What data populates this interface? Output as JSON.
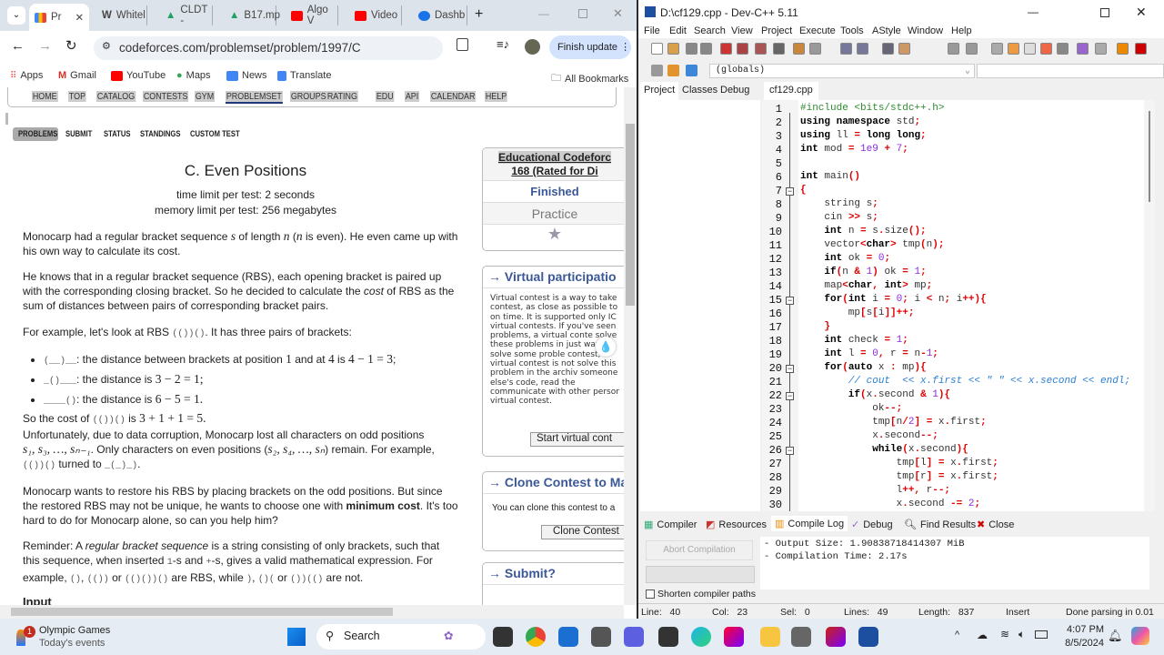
{
  "browser": {
    "tabs": [
      {
        "label": "Pr",
        "icon": "chart-icon",
        "active": true
      },
      {
        "label": "Whitel",
        "icon": "w-icon"
      },
      {
        "label": "CLDT -",
        "icon": "drive-icon"
      },
      {
        "label": "B17.mp",
        "icon": "drive-icon"
      },
      {
        "label": "Algo V",
        "icon": "youtube-icon"
      },
      {
        "label": "Video",
        "icon": "youtube-icon"
      },
      {
        "label": "Dashb",
        "icon": "dashboard-icon"
      }
    ],
    "url": "codeforces.com/problemset/problem/1997/C",
    "finish_update": "Finish update",
    "bookmarks": [
      "Apps",
      "Gmail",
      "YouTube",
      "Maps",
      "News",
      "Translate"
    ],
    "all_bookmarks": "All Bookmarks"
  },
  "cf": {
    "nav": [
      "HOME",
      "TOP",
      "CATALOG",
      "CONTESTS",
      "GYM",
      "PROBLEMSET",
      "GROUPS",
      "RATING",
      "EDU",
      "API",
      "CALENDAR",
      "HELP"
    ],
    "subnav": [
      "PROBLEMS",
      "SUBMIT",
      "STATUS",
      "STANDINGS",
      "CUSTOM TEST"
    ],
    "title": "C. Even Positions",
    "time_limit": "time limit per test: 2 seconds",
    "memory_limit": "memory limit per test: 256 megabytes",
    "p1": {
      "a": "Monocarp had a regular bracket sequence ",
      "s": "s",
      "b": " of length ",
      "n": "n",
      "c": " (",
      "n2": "n",
      "d": " is even). He even came up with his own way to calculate its cost."
    },
    "p2": {
      "a": "He knows that in a regular bracket sequence (RBS), each opening bracket is paired up with the corresponding closing bracket. So he decided to calculate the ",
      "cost": "cost",
      "b": " of RBS as the sum of distances between pairs of corresponding bracket pairs."
    },
    "p3": {
      "a": "For example, let's look at RBS ",
      "code": "(())()",
      "b": ". It has three pairs of brackets:"
    },
    "bullets": [
      {
        "code": "(__)__",
        "text": ": the distance between brackets at position ",
        "m": "1",
        " and": " and at ",
        "m2": "4",
        "is": " is ",
        "eq": "4 − 1 = 3",
        ";": ";"
      },
      {
        "code": "_()___",
        "text": ": the distance is ",
        "eq": "3 − 2 = 1;"
      },
      {
        "code": "____()",
        "text": ": the distance is ",
        "eq": "6 − 5 = 1."
      }
    ],
    "p4": {
      "a": "So the cost of ",
      "code": "(())()",
      "b": " is ",
      "eq": "3 + 1 + 1 = 5."
    },
    "p5": {
      "a": "Unfortunately, due to data corruption, Monocarp lost all characters on odd positions",
      "m1": "s₁, s₃, …, sₙ₋₁",
      "b": ". Only characters on even positions (",
      "m2": "s₂, s₄, …, sₙ",
      "c": ") remain. For example,",
      "code1": "(())()",
      "d": " turned to ",
      "code2": "_(_)_)",
      "e": "."
    },
    "p6": {
      "a": "Monocarp wants to restore his RBS by placing brackets on the odd positions. But since the restored RBS may not be unique, he wants to choose one with ",
      "b": "minimum cost",
      "c": ". It's too hard to do for Monocarp alone, so can you help him?"
    },
    "p7": {
      "a": "Reminder: A ",
      "i": "regular bracket sequence",
      "b": " is a string consisting of only brackets, such that this sequence, when inserted ",
      "c1": "1",
      "c": "-s and ",
      "c2": "+",
      "d": "-s, gives a valid mathematical expression. For example, ",
      "e1": "()",
      "sep": ", ",
      "e2": "(())",
      "or": " or ",
      "e3": "(()())()",
      "f": " are RBS, while ",
      "g1": ")",
      "g2": "()(",
      "g3": "())(()",
      "h": " are not."
    },
    "input_heading": "Input",
    "side": {
      "contest": "Educational Codeforces Round 168 (Rated for Di",
      "contest_l1": "Educational Codeforc",
      "contest_l2": "168 (Rated for Di",
      "finished": "Finished",
      "practice": "Practice",
      "virtual_title": "→ Virtual participatio",
      "virtual_text": "Virtual contest is a way to take contest, as close as possible to on time. It is supported only IC virtual contests. If you've seen problems, a virtual conte solve these problems in just want to solve some proble contest, a virtual contest is not solve this problem in the archiv someone else's code, read the communicate with other persor virtual contest.",
      "start_virtual": "Start virtual cont",
      "clone_title": "→ Clone Contest to Ma",
      "clone_text": "You can clone this contest to a",
      "clone_btn": "Clone Contest",
      "submit_title": "→ Submit?"
    }
  },
  "dev": {
    "title": "D:\\cf129.cpp - Dev-C++ 5.11",
    "menu": [
      "File",
      "Edit",
      "Search",
      "View",
      "Project",
      "Execute",
      "Tools",
      "AStyle",
      "Window",
      "Help"
    ],
    "scope": "(globals)",
    "left_tabs": [
      "Project",
      "Classes",
      "Debug"
    ],
    "file_tab": "cf129.cpp",
    "folds": [
      7,
      15,
      20,
      22,
      26
    ],
    "code": [
      [
        [
          "pp",
          "#include <bits/stdc++.h>"
        ]
      ],
      [
        [
          "k",
          "using namespace"
        ],
        [
          "t",
          " std"
        ],
        [
          "p",
          ";"
        ]
      ],
      [
        [
          "k",
          "using"
        ],
        [
          "t",
          " ll "
        ],
        [
          "p",
          "="
        ],
        [
          "k",
          " long long"
        ],
        [
          "p",
          ";"
        ]
      ],
      [
        [
          "k",
          "int"
        ],
        [
          "t",
          " mod "
        ],
        [
          "p",
          "="
        ],
        [
          "n",
          " 1e9 "
        ],
        [
          "p",
          "+"
        ],
        [
          "n",
          " 7"
        ],
        [
          "p",
          ";"
        ]
      ],
      [],
      [
        [
          "k",
          "int"
        ],
        [
          "t",
          " main"
        ],
        [
          "p",
          "()"
        ]
      ],
      [
        [
          "p",
          "{"
        ]
      ],
      [
        [
          "t",
          "    string s"
        ],
        [
          "p",
          ";"
        ]
      ],
      [
        [
          "t",
          "    cin "
        ],
        [
          "p",
          ">>"
        ],
        [
          "t",
          " s"
        ],
        [
          "p",
          ";"
        ]
      ],
      [
        [
          "k",
          "    int"
        ],
        [
          "t",
          " n "
        ],
        [
          "p",
          "="
        ],
        [
          "t",
          " s"
        ],
        [
          "p",
          "."
        ],
        [
          "t",
          "size"
        ],
        [
          "p",
          "();"
        ]
      ],
      [
        [
          "t",
          "    vector"
        ],
        [
          "p",
          "<"
        ],
        [
          "k",
          "char"
        ],
        [
          "p",
          ">"
        ],
        [
          "t",
          " tmp"
        ],
        [
          "p",
          "("
        ],
        [
          "t",
          "n"
        ],
        [
          "p",
          ");"
        ]
      ],
      [
        [
          "k",
          "    int"
        ],
        [
          "t",
          " ok "
        ],
        [
          "p",
          "="
        ],
        [
          "n",
          " 0"
        ],
        [
          "p",
          ";"
        ]
      ],
      [
        [
          "k",
          "    if"
        ],
        [
          "p",
          "("
        ],
        [
          "t",
          "n "
        ],
        [
          "p",
          "&"
        ],
        [
          "n",
          " 1"
        ],
        [
          "p",
          ")"
        ],
        [
          "t",
          " ok "
        ],
        [
          "p",
          "="
        ],
        [
          "n",
          " 1"
        ],
        [
          "p",
          ";"
        ]
      ],
      [
        [
          "t",
          "    map"
        ],
        [
          "p",
          "<"
        ],
        [
          "k",
          "char"
        ],
        [
          "p",
          ","
        ],
        [
          "k",
          " int"
        ],
        [
          "p",
          ">"
        ],
        [
          "t",
          " mp"
        ],
        [
          "p",
          ";"
        ]
      ],
      [
        [
          "k",
          "    for"
        ],
        [
          "p",
          "("
        ],
        [
          "k",
          "int"
        ],
        [
          "t",
          " i "
        ],
        [
          "p",
          "="
        ],
        [
          "n",
          " 0"
        ],
        [
          "p",
          ";"
        ],
        [
          "t",
          " i "
        ],
        [
          "p",
          "<"
        ],
        [
          "t",
          " n"
        ],
        [
          "p",
          ";"
        ],
        [
          "t",
          " i"
        ],
        [
          "p",
          "++){"
        ]
      ],
      [
        [
          "t",
          "        mp"
        ],
        [
          "p",
          "["
        ],
        [
          "t",
          "s"
        ],
        [
          "p",
          "["
        ],
        [
          "t",
          "i"
        ],
        [
          "p",
          "]]++;"
        ]
      ],
      [
        [
          "p",
          "    }"
        ]
      ],
      [
        [
          "k",
          "    int"
        ],
        [
          "t",
          " check "
        ],
        [
          "p",
          "="
        ],
        [
          "n",
          " 1"
        ],
        [
          "p",
          ";"
        ]
      ],
      [
        [
          "k",
          "    int"
        ],
        [
          "t",
          " l "
        ],
        [
          "p",
          "="
        ],
        [
          "n",
          " 0"
        ],
        [
          "p",
          ","
        ],
        [
          "t",
          " r "
        ],
        [
          "p",
          "="
        ],
        [
          "t",
          " n"
        ],
        [
          "p",
          "-"
        ],
        [
          "n",
          "1"
        ],
        [
          "p",
          ";"
        ]
      ],
      [
        [
          "k",
          "    for"
        ],
        [
          "p",
          "("
        ],
        [
          "k",
          "auto"
        ],
        [
          "t",
          " x "
        ],
        [
          "p",
          ":"
        ],
        [
          "t",
          " mp"
        ],
        [
          "p",
          "){"
        ]
      ],
      [
        [
          "t",
          "        "
        ],
        [
          "c",
          "// cout  << x.first << \" \" << x.second << endl;"
        ]
      ],
      [
        [
          "k",
          "        if"
        ],
        [
          "p",
          "("
        ],
        [
          "t",
          "x"
        ],
        [
          "p",
          "."
        ],
        [
          "t",
          "second "
        ],
        [
          "p",
          "&"
        ],
        [
          "n",
          " 1"
        ],
        [
          "p",
          "){"
        ]
      ],
      [
        [
          "t",
          "            ok"
        ],
        [
          "p",
          "--;"
        ]
      ],
      [
        [
          "t",
          "            tmp"
        ],
        [
          "p",
          "["
        ],
        [
          "t",
          "n"
        ],
        [
          "p",
          "/"
        ],
        [
          "n",
          "2"
        ],
        [
          "p",
          "]"
        ],
        [
          "t",
          " "
        ],
        [
          "p",
          "="
        ],
        [
          "t",
          " x"
        ],
        [
          "p",
          "."
        ],
        [
          "t",
          "first"
        ],
        [
          "p",
          ";"
        ]
      ],
      [
        [
          "t",
          "            x"
        ],
        [
          "p",
          "."
        ],
        [
          "t",
          "second"
        ],
        [
          "p",
          "--;"
        ]
      ],
      [
        [
          "k",
          "            while"
        ],
        [
          "p",
          "("
        ],
        [
          "t",
          "x"
        ],
        [
          "p",
          "."
        ],
        [
          "t",
          "second"
        ],
        [
          "p",
          "){"
        ]
      ],
      [
        [
          "t",
          "                tmp"
        ],
        [
          "p",
          "["
        ],
        [
          "t",
          "l"
        ],
        [
          "p",
          "]"
        ],
        [
          "t",
          " "
        ],
        [
          "p",
          "="
        ],
        [
          "t",
          " x"
        ],
        [
          "p",
          "."
        ],
        [
          "t",
          "first"
        ],
        [
          "p",
          ";"
        ]
      ],
      [
        [
          "t",
          "                tmp"
        ],
        [
          "p",
          "["
        ],
        [
          "t",
          "r"
        ],
        [
          "p",
          "]"
        ],
        [
          "t",
          " "
        ],
        [
          "p",
          "="
        ],
        [
          "t",
          " x"
        ],
        [
          "p",
          "."
        ],
        [
          "t",
          "first"
        ],
        [
          "p",
          ";"
        ]
      ],
      [
        [
          "t",
          "                l"
        ],
        [
          "p",
          "++,"
        ],
        [
          "t",
          " r"
        ],
        [
          "p",
          "--;"
        ]
      ],
      [
        [
          "t",
          "                x"
        ],
        [
          "p",
          "."
        ],
        [
          "t",
          "second "
        ],
        [
          "p",
          "-="
        ],
        [
          "n",
          " 2"
        ],
        [
          "p",
          ";"
        ]
      ]
    ],
    "bottom_tabs": [
      "Compiler",
      "Resources",
      "Compile Log",
      "Debug",
      "Find Results",
      "Close"
    ],
    "abort": "Abort Compilation",
    "shorten": "Shorten compiler paths",
    "log": [
      "- Output Size: 1.90838718414307 MiB",
      "- Compilation Time: 2.17s"
    ],
    "status": {
      "line_l": "Line:",
      "line": "40",
      "col_l": "Col:",
      "col": "23",
      "sel_l": "Sel:",
      "sel": "0",
      "lines_l": "Lines:",
      "lines": "49",
      "length_l": "Length:",
      "length": "837",
      "mode": "Insert",
      "parse": "Done parsing in 0.01"
    }
  },
  "taskbar": {
    "widget_title": "Olympic Games",
    "widget_sub": "Today's events",
    "badge": "1",
    "search": "Search",
    "time": "4:07 PM",
    "date": "8/5/2024"
  }
}
